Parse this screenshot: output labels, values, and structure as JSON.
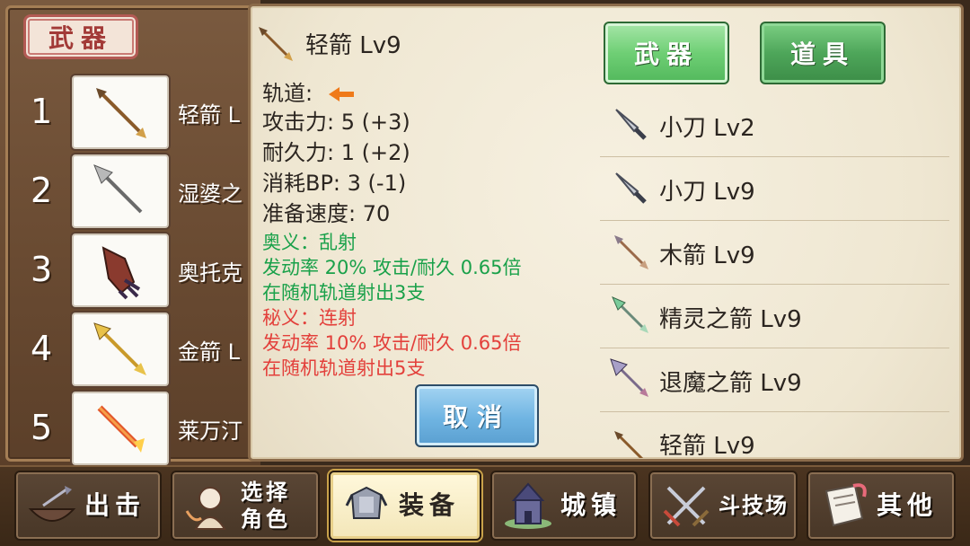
{
  "left_panel": {
    "title": "武器",
    "slots": [
      {
        "num": "1",
        "name": "轻箭 L",
        "icon": "arrow-icon"
      },
      {
        "num": "2",
        "name": "湿婆之",
        "icon": "spear-arrow-icon"
      },
      {
        "num": "3",
        "name": "奥托克",
        "icon": "claw-icon"
      },
      {
        "num": "4",
        "name": "金箭 L",
        "icon": "gold-arrow-icon"
      },
      {
        "num": "5",
        "name": "莱万汀",
        "icon": "flame-sword-icon"
      }
    ]
  },
  "detail": {
    "title": "轻箭 Lv9",
    "track_label": "轨道:",
    "stats": {
      "attack": "攻击力: 5 (+3)",
      "durability": "耐久力: 1 (+2)",
      "bp": "消耗BP: 3 (-1)",
      "speed": "准备速度: 70"
    },
    "secret_green": {
      "title": "奥义：乱射",
      "line1": "发动率 20%  攻击/耐久 0.65倍",
      "line2": "在随机轨道射出3支"
    },
    "secret_red": {
      "title": "秘义：连射",
      "line1": "发动率 10%    攻击/耐久 0.65倍",
      "line2": "在随机轨道射出5支"
    }
  },
  "tabs": {
    "weapon": "武器",
    "item": "道具"
  },
  "list": [
    {
      "label": "小刀 Lv2",
      "icon": "knife-icon"
    },
    {
      "label": "小刀 Lv9",
      "icon": "knife-icon"
    },
    {
      "label": "木箭 Lv9",
      "icon": "wood-arrow-icon"
    },
    {
      "label": "精灵之箭 Lv9",
      "icon": "elf-arrow-icon"
    },
    {
      "label": "退魔之箭 Lv9",
      "icon": "exorcism-arrow-icon"
    },
    {
      "label": "轻箭 Lv9",
      "icon": "arrow-icon"
    }
  ],
  "cancel_label": "取消",
  "nav": {
    "sortie": "出击",
    "select_role_1": "选择",
    "select_role_2": "角色",
    "equip": "装备",
    "town": "城镇",
    "arena": "斗技场",
    "other": "其他"
  },
  "colors": {
    "green_text": "#1aa14a",
    "red_text": "#e3403b",
    "tab_green": "#6fcf75",
    "cancel_blue": "#6fb4e2"
  }
}
